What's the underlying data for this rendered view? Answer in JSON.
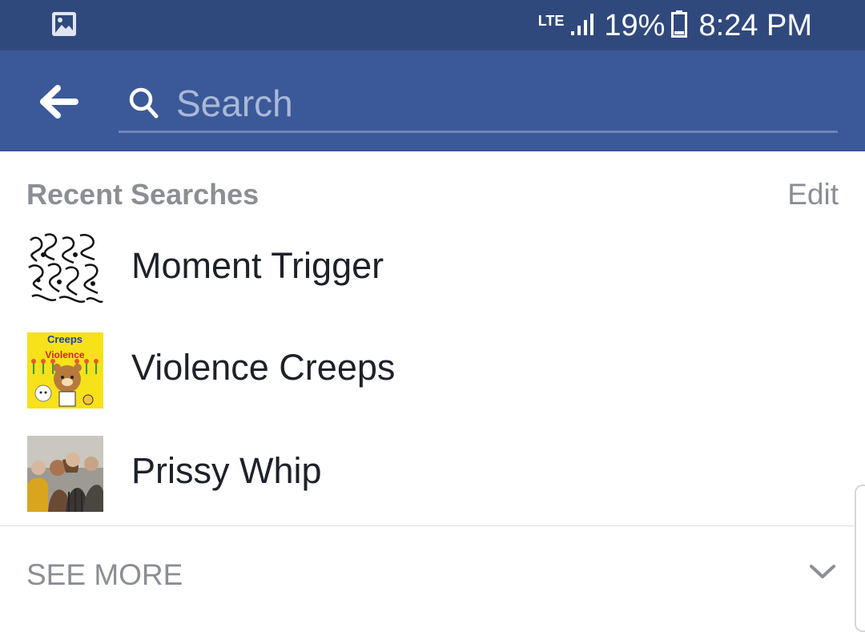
{
  "status_bar": {
    "notification_icon": "image-icon",
    "network": "LTE",
    "signal_icon": "signal-bars-icon",
    "battery_percent": "19%",
    "battery_icon": "battery-icon",
    "time": "8:24 PM"
  },
  "app_bar": {
    "back_icon": "arrow-left-icon",
    "search_icon": "search-icon",
    "search_placeholder": "Search",
    "search_value": ""
  },
  "recent": {
    "title": "Recent Searches",
    "edit_label": "Edit",
    "items": [
      {
        "name": "Moment Trigger"
      },
      {
        "name": "Violence Creeps",
        "thumb_text_top": "Creeps",
        "thumb_text_bottom": "Violence"
      },
      {
        "name": "Prissy Whip"
      }
    ]
  },
  "see_more": {
    "label": "SEE MORE",
    "icon": "chevron-down-icon"
  },
  "colors": {
    "status_bar": "#30497d",
    "app_bar": "#3b5998",
    "secondary_text": "#8b8e94",
    "primary_text": "#1d2129"
  }
}
